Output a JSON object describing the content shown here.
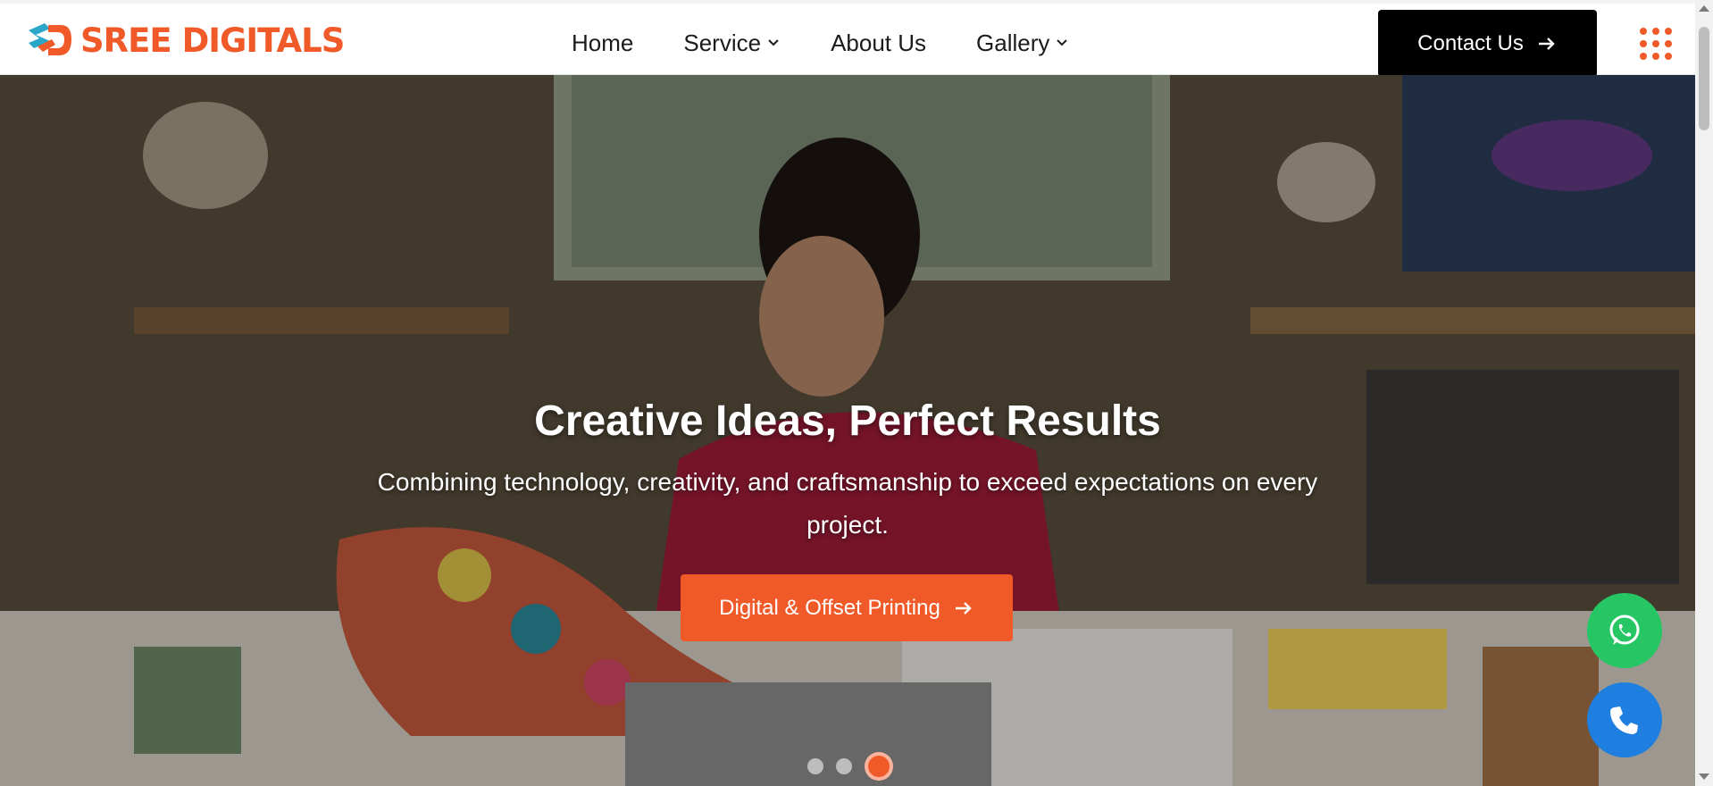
{
  "brand": {
    "name": "SREE DIGITALS",
    "color": "#f05a28"
  },
  "nav": {
    "items": [
      {
        "label": "Home",
        "has_dropdown": false
      },
      {
        "label": "Service",
        "has_dropdown": true
      },
      {
        "label": "About Us",
        "has_dropdown": false
      },
      {
        "label": "Gallery",
        "has_dropdown": true
      }
    ],
    "contact_label": "Contact Us",
    "menu_icon": "grid-dots-icon"
  },
  "hero": {
    "title": "Creative Ideas, Perfect Results",
    "subtitle": "Combining technology, creativity, and craftsmanship to exceed expectations on every project.",
    "cta_label": "Digital & Offset Printing",
    "slides": {
      "count": 3,
      "active_index": 2
    }
  },
  "floating": {
    "whatsapp_icon": "whatsapp-icon",
    "whatsapp_color": "#27c665",
    "phone_icon": "phone-icon",
    "phone_color": "#1e7fe0"
  },
  "colors": {
    "accent": "#f05a28",
    "contact_bg": "#000000"
  }
}
